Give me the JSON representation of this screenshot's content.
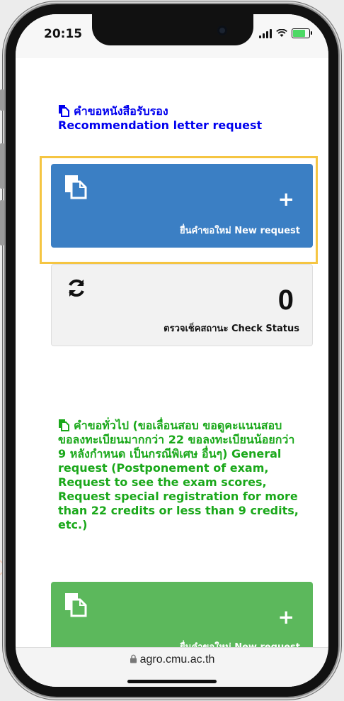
{
  "status_bar": {
    "time": "20:15"
  },
  "recommendation": {
    "heading_line1": "คำขอหนังสือรับรอง",
    "heading_line2": "Recommendation letter request",
    "new_request": {
      "plus": "+",
      "label": "ยื่นคำขอใหม่ New request"
    },
    "check_status": {
      "count": "0",
      "label": "ตรวจเช็คสถานะ Check Status"
    }
  },
  "general": {
    "heading": "คำขอทั่วไป (ขอเลื่อนสอบ ขอดูคะแนนสอบ ขอลงทะเบียนมากกว่า 22 ขอลงทะเบียนน้อยกว่า 9 หลังกำหนด เป็นกรณีพิเศษ อื่นๆ) General request (Postponement of exam, Request to see the exam scores, Request special registration for more than 22 credits or less than 9 credits, etc.)",
    "new_request": {
      "plus": "+",
      "label": "ยื่นคำขอใหม่ New request"
    }
  },
  "browser": {
    "url": "agro.cmu.ac.th"
  },
  "colors": {
    "blue_heading": "#0000ee",
    "blue_card": "#3b7fc4",
    "green_heading": "#1aa81a",
    "green_card": "#5cb85c",
    "highlight": "#f5c542"
  }
}
